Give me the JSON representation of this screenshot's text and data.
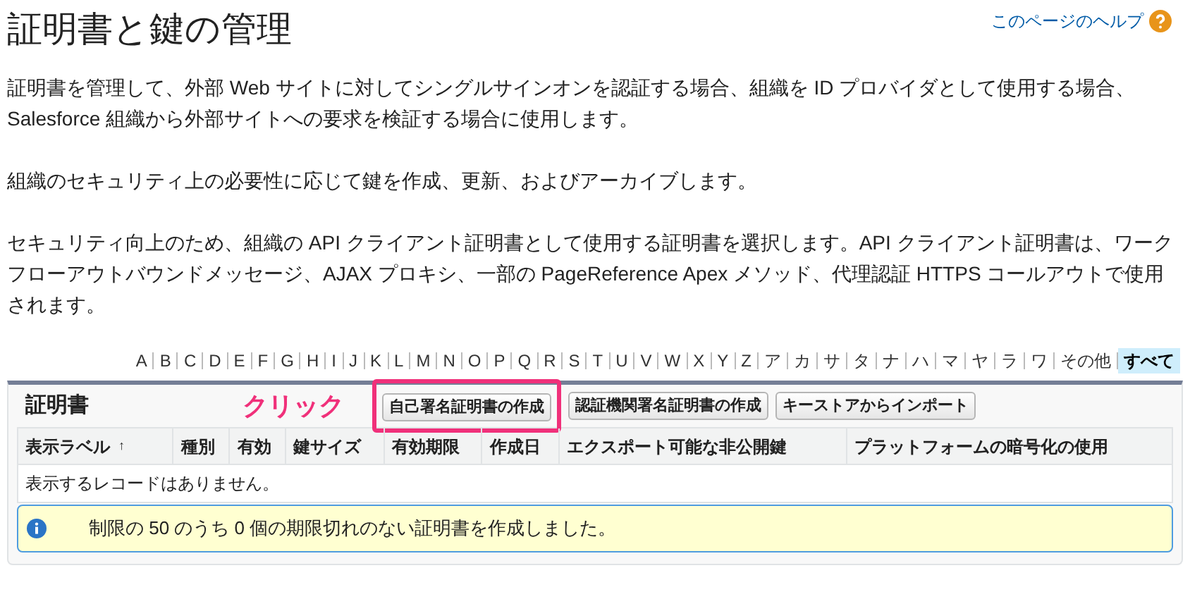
{
  "page": {
    "title": "証明書と鍵の管理",
    "help_link": "このページのヘルプ"
  },
  "paragraphs": [
    "証明書を管理して、外部 Web サイトに対してシングルサインオンを認証する場合、組織を ID プロバイダとして使用する場合、Salesforce 組織から外部サイトへの要求を検証する場合に使用します。",
    "組織のセキュリティ上の必要性に応じて鍵を作成、更新、およびアーカイブします。",
    "セキュリティ向上のため、組織の API クライアント証明書として使用する証明書を選択します。API クライアント証明書は、ワークフローアウトバウンドメッセージ、AJAX プロキシ、一部の PageReference Apex メソッド、代理認証 HTTPS コールアウトで使用されます。"
  ],
  "alphabet": [
    {
      "label": "A",
      "selected": false
    },
    {
      "label": "B",
      "selected": false
    },
    {
      "label": "C",
      "selected": false
    },
    {
      "label": "D",
      "selected": false
    },
    {
      "label": "E",
      "selected": false
    },
    {
      "label": "F",
      "selected": false
    },
    {
      "label": "G",
      "selected": false
    },
    {
      "label": "H",
      "selected": false
    },
    {
      "label": "I",
      "selected": false
    },
    {
      "label": "J",
      "selected": false
    },
    {
      "label": "K",
      "selected": false
    },
    {
      "label": "L",
      "selected": false
    },
    {
      "label": "M",
      "selected": false
    },
    {
      "label": "N",
      "selected": false
    },
    {
      "label": "O",
      "selected": false
    },
    {
      "label": "P",
      "selected": false
    },
    {
      "label": "Q",
      "selected": false
    },
    {
      "label": "R",
      "selected": false
    },
    {
      "label": "S",
      "selected": false
    },
    {
      "label": "T",
      "selected": false
    },
    {
      "label": "U",
      "selected": false
    },
    {
      "label": "V",
      "selected": false
    },
    {
      "label": "W",
      "selected": false
    },
    {
      "label": "X",
      "selected": false
    },
    {
      "label": "Y",
      "selected": false
    },
    {
      "label": "Z",
      "selected": false
    },
    {
      "label": "ア",
      "selected": false
    },
    {
      "label": "カ",
      "selected": false
    },
    {
      "label": "サ",
      "selected": false
    },
    {
      "label": "タ",
      "selected": false
    },
    {
      "label": "ナ",
      "selected": false
    },
    {
      "label": "ハ",
      "selected": false
    },
    {
      "label": "マ",
      "selected": false
    },
    {
      "label": "ヤ",
      "selected": false
    },
    {
      "label": "ラ",
      "selected": false
    },
    {
      "label": "ワ",
      "selected": false
    },
    {
      "label": "その他",
      "selected": false
    },
    {
      "label": "すべて",
      "selected": true
    }
  ],
  "panel": {
    "title": "証明書",
    "annotation": "クリック",
    "buttons": [
      {
        "label": "自己署名証明書の作成",
        "highlighted": true
      },
      {
        "label": "認証機関署名証明書の作成",
        "highlighted": false
      },
      {
        "label": "キーストアからインポート",
        "highlighted": false
      }
    ],
    "columns": [
      {
        "label": "表示ラベル",
        "sort": "↑"
      },
      {
        "label": "種別"
      },
      {
        "label": "有効"
      },
      {
        "label": "鍵サイズ"
      },
      {
        "label": "有効期限"
      },
      {
        "label": "作成日"
      },
      {
        "label": "エクスポート可能な非公開鍵"
      },
      {
        "label": "プラットフォームの暗号化の使用"
      }
    ],
    "empty_message": "表示するレコードはありません。",
    "info_message": "制限の 50 のうち 0 個の期限切れのない証明書を作成しました。"
  }
}
